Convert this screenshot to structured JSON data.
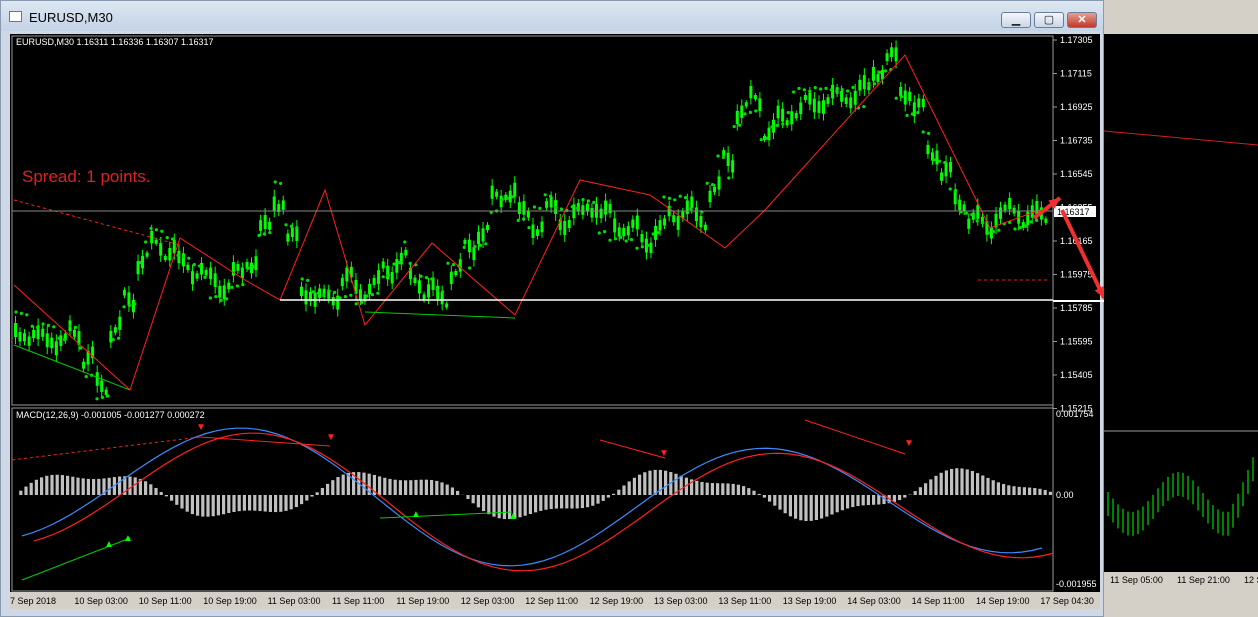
{
  "window": {
    "title": "EURUSD,M30",
    "buttons": {
      "minimize": "▁",
      "maximize": "▢",
      "close": "✕"
    }
  },
  "chart": {
    "symbol_info": "EURUSD,M30  1.16311 1.16336 1.16307 1.16317",
    "spread_text": "Spread: 1 points.",
    "current_price": "1.16317",
    "price_axis": [
      "1.17305",
      "1.17115",
      "1.16925",
      "1.16735",
      "1.16545",
      "1.16355",
      "1.16165",
      "1.15975",
      "1.15785",
      "1.15595",
      "1.15405",
      "1.15215"
    ],
    "macd_info": "MACD(12,26,9) -0.001005 -0.001277 0.000272",
    "macd_axis": [
      "0.001754",
      "0.00",
      "-0.001955"
    ],
    "time_axis": [
      "7 Sep 2018",
      "10 Sep 03:00",
      "10 Sep 11:00",
      "10 Sep 19:00",
      "11 Sep 03:00",
      "11 Sep 11:00",
      "11 Sep 19:00",
      "12 Sep 03:00",
      "12 Sep 11:00",
      "12 Sep 19:00",
      "13 Sep 03:00",
      "13 Sep 11:00",
      "13 Sep 19:00",
      "14 Sep 03:00",
      "14 Sep 11:00",
      "14 Sep 19:00",
      "17 Sep 04:30"
    ],
    "colors": {
      "candle": "#00ff00",
      "sar": "#00e000",
      "zigzag": "#ff2020",
      "macd_main": "#3b8cff",
      "macd_signal": "#ff2020",
      "histogram": "#c0c0c0",
      "background": "#000000"
    }
  },
  "second_chart": {
    "time_axis": [
      "11 Sep 05:00",
      "11 Sep 21:00",
      "12 S"
    ]
  }
}
